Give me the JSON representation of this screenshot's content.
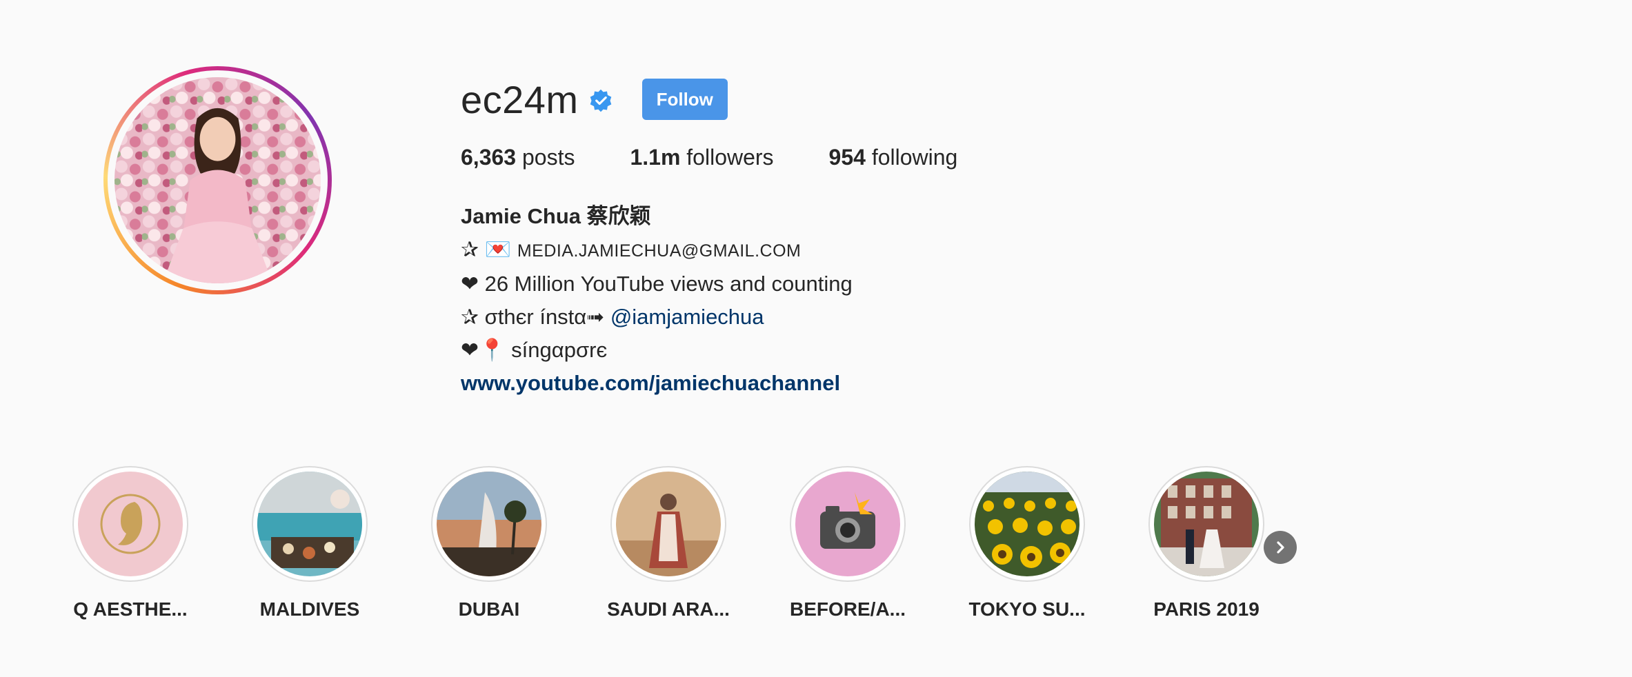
{
  "profile": {
    "username": "ec24m",
    "follow_label": "Follow",
    "avatar_icon": "profile-photo"
  },
  "stats": {
    "posts_count": "6,363",
    "posts_label": " posts",
    "followers_count": "1.1m",
    "followers_label": " followers",
    "following_count": "954",
    "following_label": " following"
  },
  "bio": {
    "name": "Jamie Chua 蔡欣颖",
    "line1_prefix": "✰ 💌 ",
    "line1_email": "MEDIA.JAMIECHUA@GMAIL.COM",
    "line2": "❤ 26 Million YouTube views and counting",
    "line3_prefix": "✰ σthєr ínstα➟ ",
    "line3_mention": "@iamjamiechua",
    "line4": "❤📍 síngαpσrє",
    "website": "www.youtube.com/jamiechuachannel"
  },
  "highlights": [
    {
      "label": "Q AESTHE..."
    },
    {
      "label": "MALDIVES"
    },
    {
      "label": "DUBAI"
    },
    {
      "label": "SAUDI ARA..."
    },
    {
      "label": "BEFORE/A..."
    },
    {
      "label": "TOKYO SU..."
    },
    {
      "label": "PARIS 2019"
    }
  ],
  "colors": {
    "follow_button": "#4a95e8",
    "link": "#003569",
    "verified": "#3897f0"
  }
}
